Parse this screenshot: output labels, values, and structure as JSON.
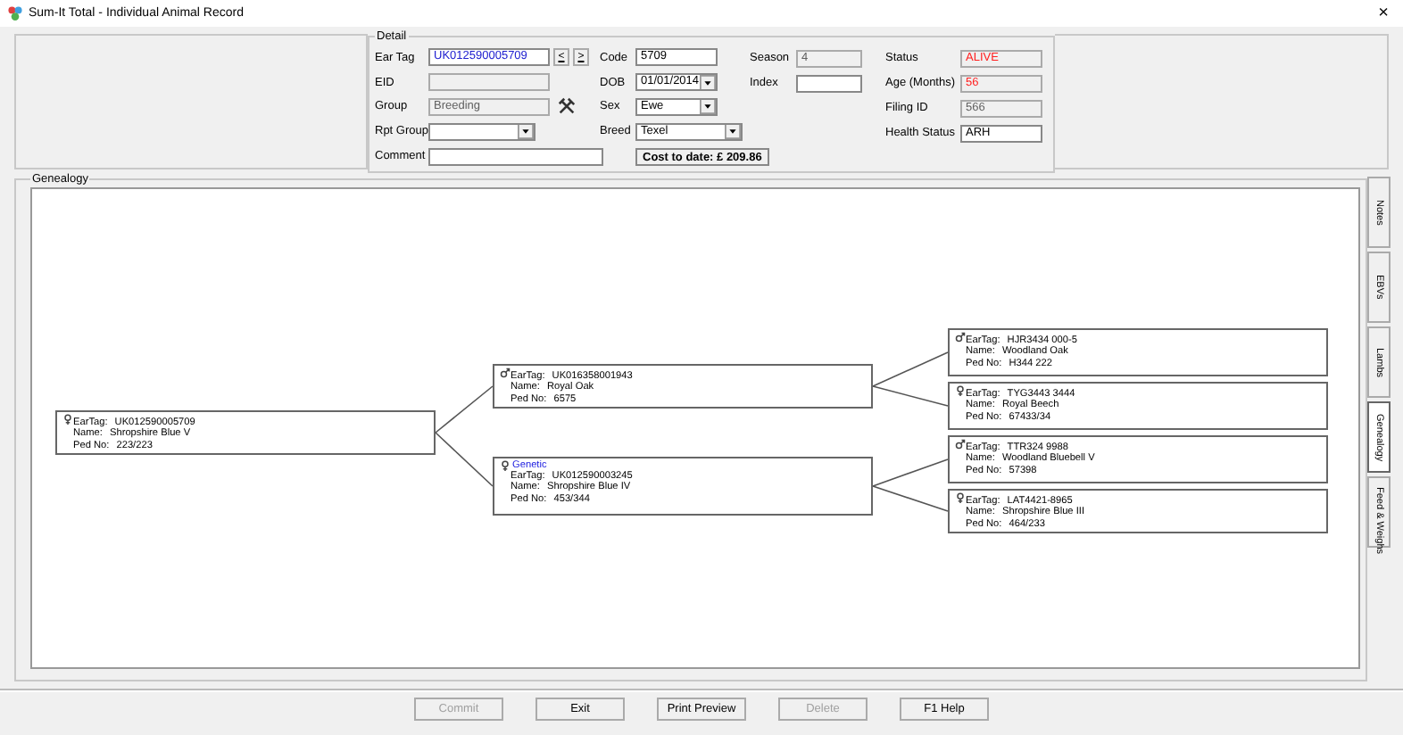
{
  "window": {
    "title": "Sum-It Total - Individual Animal Record",
    "close": "×"
  },
  "detail": {
    "legend": "Detail",
    "columns": [
      {
        "fields": [
          {
            "label": "Ear Tag",
            "value": "UK012590005709",
            "kind": "text",
            "disabled": false,
            "color": "#2020d0",
            "buttons": [
              "<",
              ">"
            ]
          },
          {
            "label": "EID",
            "kind": "text",
            "disabled": true
          },
          {
            "label": "Group",
            "value": "Breeding",
            "kind": "text",
            "disabled": true,
            "tool_button": true
          },
          {
            "label": "Rpt Group",
            "kind": "dropdown",
            "disabled": false
          },
          {
            "label": "Comment",
            "kind": "text",
            "disabled": false
          }
        ]
      },
      {
        "fields": [
          {
            "label": "Code",
            "value": "5709",
            "kind": "text",
            "disabled": false
          },
          {
            "label": "DOB",
            "value": "01/01/2014",
            "kind": "dropdown",
            "disabled": false
          },
          {
            "label": "Sex",
            "value": "Ewe",
            "kind": "dropdown",
            "disabled": false
          },
          {
            "label": "Breed",
            "value": "Texel",
            "kind": "dropdown",
            "disabled": false
          },
          {
            "value": "Cost to date: £ 209.86",
            "kind": "summary"
          }
        ]
      },
      {
        "fields": [
          {
            "label": "Season",
            "value": "4",
            "kind": "text",
            "disabled": true
          },
          {
            "label": "Index",
            "kind": "text",
            "disabled": false
          }
        ]
      },
      {
        "fields": [
          {
            "label": "Status",
            "value": "ALIVE",
            "kind": "text",
            "disabled": true,
            "color": "#ff2020"
          },
          {
            "label": "Age (Months)",
            "value": "56",
            "kind": "text",
            "disabled": true,
            "color": "#ff2020"
          },
          {
            "label": "Filing ID",
            "value": "566",
            "kind": "text",
            "disabled": true
          },
          {
            "label": "Health Status",
            "value": "ARH",
            "kind": "text",
            "disabled": false
          }
        ]
      }
    ]
  },
  "genealogy": {
    "title": "Genealogy",
    "tree": {
      "kind": "female",
      "fields": [
        {
          "label": "EarTag:",
          "value": "UK012590005709"
        },
        {
          "label": "Name:",
          "value": "Shropshire Blue V"
        },
        {
          "label": "Ped No:",
          "value": "223/223"
        }
      ],
      "children": [
        {
          "kind": "male",
          "fields": [
            {
              "label": "EarTag:",
              "value": "UK016358001943"
            },
            {
              "label": "Name:",
              "value": "Royal Oak"
            },
            {
              "label": "Ped No:",
              "value": "6575"
            }
          ],
          "children": [
            {
              "kind": "male",
              "fields": [
                {
                  "label": "EarTag:",
                  "value": "HJR3434 000-5"
                },
                {
                  "label": "Name:",
                  "value": "Woodland Oak"
                },
                {
                  "label": "Ped No:",
                  "value": "H344 222"
                }
              ]
            },
            {
              "kind": "female",
              "fields": [
                {
                  "label": "EarTag:",
                  "value": "TYG3443 3444"
                },
                {
                  "label": "Name:",
                  "value": "Royal Beech"
                },
                {
                  "label": "Ped No:",
                  "value": "67433/34"
                }
              ]
            }
          ]
        },
        {
          "kind": "female",
          "badge": "Genetic",
          "fields": [
            {
              "label": "EarTag:",
              "value": "UK012590003245"
            },
            {
              "label": "Name:",
              "value": "Shropshire Blue IV"
            },
            {
              "label": "Ped No:",
              "value": "453/344"
            }
          ],
          "children": [
            {
              "kind": "male",
              "fields": [
                {
                  "label": "EarTag:",
                  "value": "TTR324 9988"
                },
                {
                  "label": "Name:",
                  "value": "Woodland Bluebell V"
                },
                {
                  "label": "Ped No:",
                  "value": "57398"
                }
              ]
            },
            {
              "kind": "female",
              "fields": [
                {
                  "label": "EarTag:",
                  "value": "LAT4421-8965"
                },
                {
                  "label": "Name:",
                  "value": "Shropshire Blue III"
                },
                {
                  "label": "Ped No:",
                  "value": "464/233"
                }
              ]
            }
          ]
        }
      ]
    }
  },
  "side_tabs": [
    {
      "label": "Notes",
      "selected": false
    },
    {
      "label": "EBVs",
      "selected": false
    },
    {
      "label": "Lambs",
      "selected": false
    },
    {
      "label": "Genealogy",
      "selected": true
    },
    {
      "label": "Feed & Weighs",
      "selected": false
    }
  ],
  "buttons": [
    {
      "label": "Commit",
      "disabled": true
    },
    {
      "label": "Exit",
      "disabled": false
    },
    {
      "label": "Print Preview",
      "disabled": false
    },
    {
      "label": "Delete",
      "disabled": true
    },
    {
      "label": "F1 Help",
      "disabled": false
    }
  ]
}
